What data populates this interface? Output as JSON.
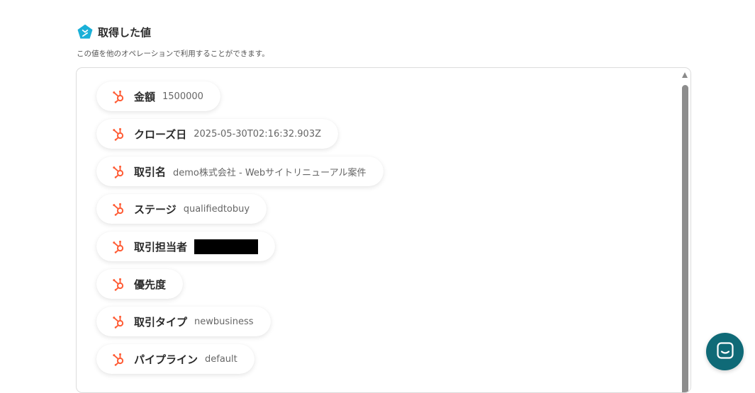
{
  "header": {
    "title": "取得した値",
    "subtitle": "この値を他のオペレーションで利用することができます。"
  },
  "fields": [
    {
      "label": "金額",
      "value": "1500000"
    },
    {
      "label": "クローズ日",
      "value": "2025-05-30T02:16:32.903Z"
    },
    {
      "label": "取引名",
      "value": "demo株式会社 - Webサイトリニューアル案件"
    },
    {
      "label": "ステージ",
      "value": "qualifiedtobuy"
    },
    {
      "label": "取引担当者",
      "value": ""
    },
    {
      "label": "優先度",
      "value": ""
    },
    {
      "label": "取引タイプ",
      "value": "newbusiness"
    },
    {
      "label": "パイプライン",
      "value": "default"
    }
  ],
  "icons": {
    "header": "yoom-pentagon-icon",
    "field": "hubspot-icon",
    "chat": "chat-icon"
  },
  "colors": {
    "brand": "#1ab0d8",
    "hubspot": "#ff5c35",
    "chat": "#0f6a77"
  }
}
